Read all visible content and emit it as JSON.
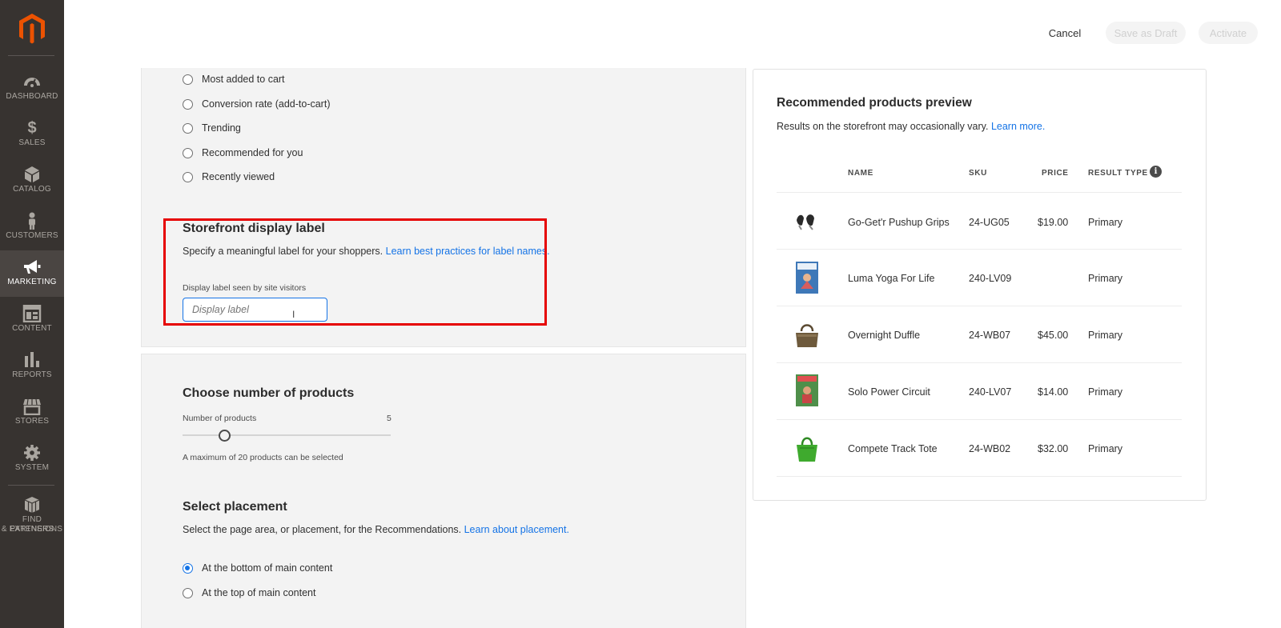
{
  "sidebar": {
    "logo": "magento-logo",
    "items": [
      {
        "label": "DASHBOARD",
        "icon": "dashboard-icon"
      },
      {
        "label": "SALES",
        "icon": "dollar-icon"
      },
      {
        "label": "CATALOG",
        "icon": "box-icon"
      },
      {
        "label": "CUSTOMERS",
        "icon": "person-icon"
      },
      {
        "label": "MARKETING",
        "icon": "megaphone-icon",
        "active": true
      },
      {
        "label": "CONTENT",
        "icon": "layout-icon"
      },
      {
        "label": "REPORTS",
        "icon": "bar-chart-icon"
      },
      {
        "label": "STORES",
        "icon": "storefront-icon"
      },
      {
        "label": "SYSTEM",
        "icon": "gear-icon"
      },
      {
        "label_line1": "FIND PARTNERS",
        "label_line2": "& EXTENSIONS",
        "icon": "cubes-icon"
      }
    ]
  },
  "header": {
    "cancel_label": "Cancel",
    "save_draft_label": "Save as Draft",
    "activate_label": "Activate"
  },
  "recommendation_types": {
    "options": [
      {
        "label": "Most added to cart",
        "checked": false
      },
      {
        "label": "Conversion rate (add-to-cart)",
        "checked": false
      },
      {
        "label": "Trending",
        "checked": false
      },
      {
        "label": "Recommended for you",
        "checked": false
      },
      {
        "label": "Recently viewed",
        "checked": false
      }
    ]
  },
  "storefront_label": {
    "title": "Storefront display label",
    "description": "Specify a meaningful label for your shoppers.",
    "link": "Learn best practices for label names.",
    "field_label": "Display label seen by site visitors",
    "placeholder": "Display label",
    "value": ""
  },
  "products_count": {
    "title": "Choose number of products",
    "field_label": "Number of products",
    "value": "5",
    "hint": "A maximum of 20 products can be selected",
    "slider_fraction": 0.2
  },
  "placement": {
    "title": "Select placement",
    "description": "Select the page area, or placement, for the Recommendations.",
    "link": "Learn about placement.",
    "options": [
      {
        "label": "At the bottom of main content",
        "checked": true
      },
      {
        "label": "At the top of main content",
        "checked": false
      }
    ]
  },
  "preview": {
    "title": "Recommended products preview",
    "subtitle": "Results on the storefront may occasionally vary.",
    "link": "Learn more.",
    "columns": {
      "name": "NAME",
      "sku": "SKU",
      "price": "PRICE",
      "result_type": "RESULT TYPE"
    },
    "info_icon": "info-icon",
    "rows": [
      {
        "name": "Go-Get'r Pushup Grips",
        "sku": "24-UG05",
        "price": "$19.00",
        "result_type": "Primary",
        "thumb": "pushup-grips-image"
      },
      {
        "name": "Luma Yoga For Life",
        "sku": "240-LV09",
        "price": "",
        "result_type": "Primary",
        "thumb": "yoga-dvd-image"
      },
      {
        "name": "Overnight Duffle",
        "sku": "24-WB07",
        "price": "$45.00",
        "result_type": "Primary",
        "thumb": "duffle-bag-image"
      },
      {
        "name": "Solo Power Circuit",
        "sku": "240-LV07",
        "price": "$14.00",
        "result_type": "Primary",
        "thumb": "power-circuit-dvd-image"
      },
      {
        "name": "Compete Track Tote",
        "sku": "24-WB02",
        "price": "$32.00",
        "result_type": "Primary",
        "thumb": "green-tote-image"
      }
    ]
  },
  "colors": {
    "sidebar": "#373330",
    "accent": "#1473e6",
    "highlight": "#e60000",
    "logo": "#eb5202"
  }
}
